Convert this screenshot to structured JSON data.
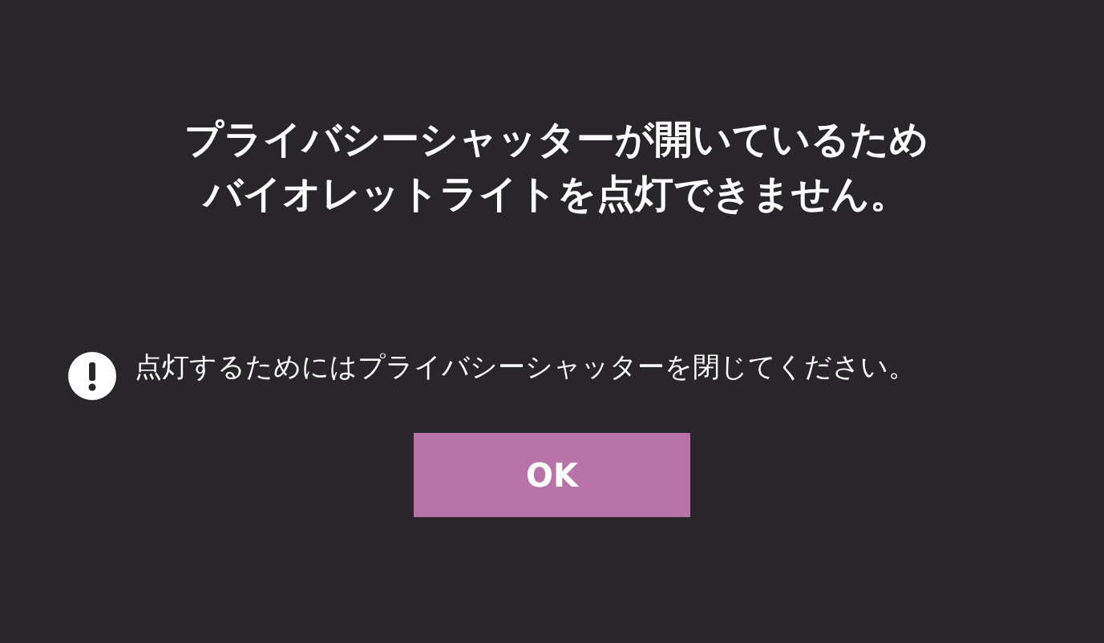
{
  "dialog": {
    "title_lines": [
      "プライバシーシャッターが開いているため",
      "バイオレットライトを点灯できません。"
    ],
    "message": "点灯するためにはプライバシーシャッターを閉じてください。",
    "buttons": [
      {
        "label": "OK",
        "kind": "primary"
      }
    ]
  }
}
